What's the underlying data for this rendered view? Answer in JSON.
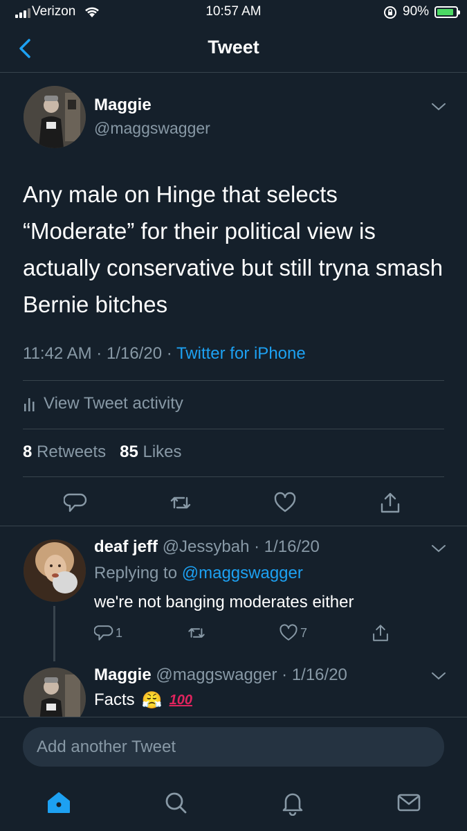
{
  "status_bar": {
    "carrier": "Verizon",
    "time": "10:57 AM",
    "battery": "90%",
    "battery_level": 0.9
  },
  "nav": {
    "title": "Tweet"
  },
  "tweet": {
    "author_name": "Maggie",
    "author_handle": "@maggswagger",
    "text": "Any male on Hinge that selects “Moderate” for their political view is actually conservative but still tryna smash Bernie bitches",
    "time": "11:42 AM",
    "date": "1/16/20",
    "source": "Twitter for iPhone",
    "activity_label": "View Tweet activity",
    "retweets_count": "8",
    "retweets_label": "Retweets",
    "likes_count": "85",
    "likes_label": "Likes"
  },
  "replies": [
    {
      "name": "deaf jeff",
      "handle": "@Jessybah",
      "date": "1/16/20",
      "replying_prefix": "Replying to",
      "replying_to": "@maggswagger",
      "text": "we're not banging moderates either",
      "reply_count": "1",
      "like_count": "7"
    },
    {
      "name": "Maggie",
      "handle": "@maggswagger",
      "date": "1/16/20",
      "text": "Facts",
      "emoji_1": "😤",
      "emoji_2": "100"
    }
  ],
  "compose": {
    "placeholder": "Add another Tweet"
  },
  "colors": {
    "background": "#15202b",
    "accent": "#1da1f2",
    "muted": "#8899a6",
    "divider": "#38444d",
    "battery": "#4cd964"
  },
  "icons": {
    "back": "chevron-left-icon",
    "caret": "chevron-down-icon",
    "reply": "speech-bubble-icon",
    "retweet": "retweet-icon",
    "like": "heart-icon",
    "share": "share-icon",
    "home": "home-icon",
    "search": "search-icon",
    "notifications": "bell-icon",
    "messages": "envelope-icon"
  }
}
